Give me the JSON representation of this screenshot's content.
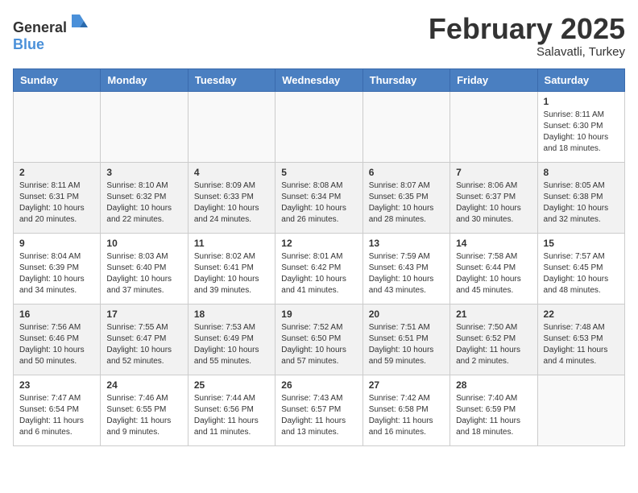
{
  "logo": {
    "text_general": "General",
    "text_blue": "Blue"
  },
  "title": {
    "month_year": "February 2025",
    "location": "Salavatli, Turkey"
  },
  "days_of_week": [
    "Sunday",
    "Monday",
    "Tuesday",
    "Wednesday",
    "Thursday",
    "Friday",
    "Saturday"
  ],
  "weeks": [
    {
      "shade": false,
      "days": [
        {
          "num": "",
          "info": ""
        },
        {
          "num": "",
          "info": ""
        },
        {
          "num": "",
          "info": ""
        },
        {
          "num": "",
          "info": ""
        },
        {
          "num": "",
          "info": ""
        },
        {
          "num": "",
          "info": ""
        },
        {
          "num": "1",
          "info": "Sunrise: 8:11 AM\nSunset: 6:30 PM\nDaylight: 10 hours\nand 18 minutes."
        }
      ]
    },
    {
      "shade": true,
      "days": [
        {
          "num": "2",
          "info": "Sunrise: 8:11 AM\nSunset: 6:31 PM\nDaylight: 10 hours\nand 20 minutes."
        },
        {
          "num": "3",
          "info": "Sunrise: 8:10 AM\nSunset: 6:32 PM\nDaylight: 10 hours\nand 22 minutes."
        },
        {
          "num": "4",
          "info": "Sunrise: 8:09 AM\nSunset: 6:33 PM\nDaylight: 10 hours\nand 24 minutes."
        },
        {
          "num": "5",
          "info": "Sunrise: 8:08 AM\nSunset: 6:34 PM\nDaylight: 10 hours\nand 26 minutes."
        },
        {
          "num": "6",
          "info": "Sunrise: 8:07 AM\nSunset: 6:35 PM\nDaylight: 10 hours\nand 28 minutes."
        },
        {
          "num": "7",
          "info": "Sunrise: 8:06 AM\nSunset: 6:37 PM\nDaylight: 10 hours\nand 30 minutes."
        },
        {
          "num": "8",
          "info": "Sunrise: 8:05 AM\nSunset: 6:38 PM\nDaylight: 10 hours\nand 32 minutes."
        }
      ]
    },
    {
      "shade": false,
      "days": [
        {
          "num": "9",
          "info": "Sunrise: 8:04 AM\nSunset: 6:39 PM\nDaylight: 10 hours\nand 34 minutes."
        },
        {
          "num": "10",
          "info": "Sunrise: 8:03 AM\nSunset: 6:40 PM\nDaylight: 10 hours\nand 37 minutes."
        },
        {
          "num": "11",
          "info": "Sunrise: 8:02 AM\nSunset: 6:41 PM\nDaylight: 10 hours\nand 39 minutes."
        },
        {
          "num": "12",
          "info": "Sunrise: 8:01 AM\nSunset: 6:42 PM\nDaylight: 10 hours\nand 41 minutes."
        },
        {
          "num": "13",
          "info": "Sunrise: 7:59 AM\nSunset: 6:43 PM\nDaylight: 10 hours\nand 43 minutes."
        },
        {
          "num": "14",
          "info": "Sunrise: 7:58 AM\nSunset: 6:44 PM\nDaylight: 10 hours\nand 45 minutes."
        },
        {
          "num": "15",
          "info": "Sunrise: 7:57 AM\nSunset: 6:45 PM\nDaylight: 10 hours\nand 48 minutes."
        }
      ]
    },
    {
      "shade": true,
      "days": [
        {
          "num": "16",
          "info": "Sunrise: 7:56 AM\nSunset: 6:46 PM\nDaylight: 10 hours\nand 50 minutes."
        },
        {
          "num": "17",
          "info": "Sunrise: 7:55 AM\nSunset: 6:47 PM\nDaylight: 10 hours\nand 52 minutes."
        },
        {
          "num": "18",
          "info": "Sunrise: 7:53 AM\nSunset: 6:49 PM\nDaylight: 10 hours\nand 55 minutes."
        },
        {
          "num": "19",
          "info": "Sunrise: 7:52 AM\nSunset: 6:50 PM\nDaylight: 10 hours\nand 57 minutes."
        },
        {
          "num": "20",
          "info": "Sunrise: 7:51 AM\nSunset: 6:51 PM\nDaylight: 10 hours\nand 59 minutes."
        },
        {
          "num": "21",
          "info": "Sunrise: 7:50 AM\nSunset: 6:52 PM\nDaylight: 11 hours\nand 2 minutes."
        },
        {
          "num": "22",
          "info": "Sunrise: 7:48 AM\nSunset: 6:53 PM\nDaylight: 11 hours\nand 4 minutes."
        }
      ]
    },
    {
      "shade": false,
      "days": [
        {
          "num": "23",
          "info": "Sunrise: 7:47 AM\nSunset: 6:54 PM\nDaylight: 11 hours\nand 6 minutes."
        },
        {
          "num": "24",
          "info": "Sunrise: 7:46 AM\nSunset: 6:55 PM\nDaylight: 11 hours\nand 9 minutes."
        },
        {
          "num": "25",
          "info": "Sunrise: 7:44 AM\nSunset: 6:56 PM\nDaylight: 11 hours\nand 11 minutes."
        },
        {
          "num": "26",
          "info": "Sunrise: 7:43 AM\nSunset: 6:57 PM\nDaylight: 11 hours\nand 13 minutes."
        },
        {
          "num": "27",
          "info": "Sunrise: 7:42 AM\nSunset: 6:58 PM\nDaylight: 11 hours\nand 16 minutes."
        },
        {
          "num": "28",
          "info": "Sunrise: 7:40 AM\nSunset: 6:59 PM\nDaylight: 11 hours\nand 18 minutes."
        },
        {
          "num": "",
          "info": ""
        }
      ]
    }
  ]
}
